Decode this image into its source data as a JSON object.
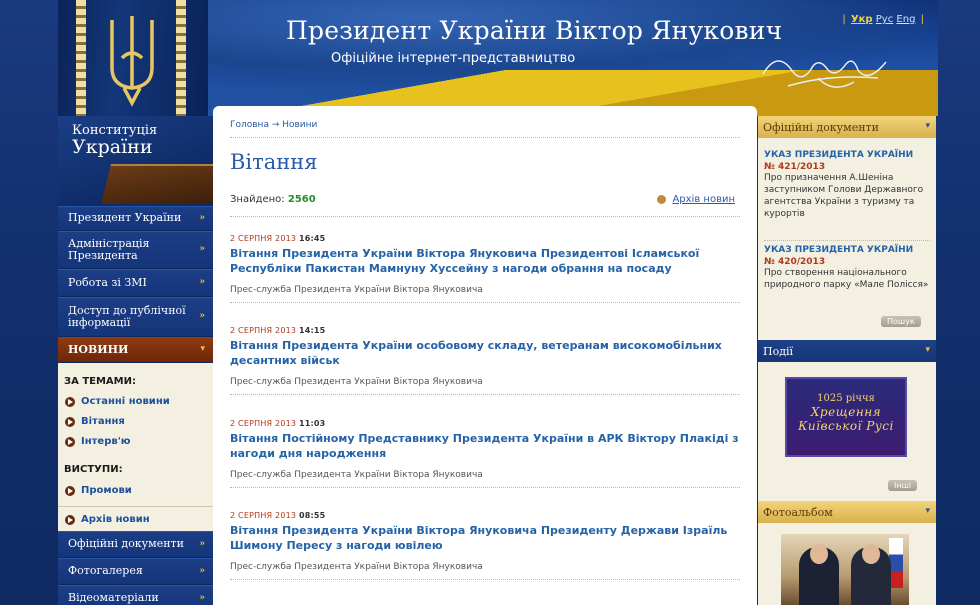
{
  "header": {
    "title": "Президент України Віктор Янукович",
    "subtitle": "Офіційне інтернет-представництво",
    "languages": [
      {
        "label": "Укр",
        "active": true
      },
      {
        "label": "Рус",
        "active": false
      },
      {
        "label": "Eng",
        "active": false
      }
    ]
  },
  "constitution": {
    "line1": "Конституція",
    "line2": "України"
  },
  "nav": [
    {
      "label": "Президент України"
    },
    {
      "label": "Адміністрація Президента"
    },
    {
      "label": "Робота зі ЗМІ"
    },
    {
      "label": "Доступ до публічної інформації"
    },
    {
      "label": "НОВИНИ"
    },
    {
      "label": "Офіційні документи"
    },
    {
      "label": "Фотогалерея"
    },
    {
      "label": "Відеоматеріали"
    }
  ],
  "topics": {
    "heading": "ЗА ТЕМАМИ:",
    "items": [
      "Останні новини",
      "Вітання",
      "Інтерв'ю"
    ],
    "speeches_heading": "ВИСТУПИ:",
    "speeches": [
      "Промови"
    ],
    "archive": "Архів новин"
  },
  "main": {
    "breadcrumb": "Головна → Новини",
    "title": "Вітання",
    "found_label": "Знайдено:",
    "found_count": "2560",
    "archive_link": "Архів новин",
    "news": [
      {
        "date": "2 СЕРПНЯ 2013",
        "time": "16:45",
        "title": "Вітання Президента України Віктора Януковича Президентові Ісламської Республіки Пакистан Мамнуну Хуссейну з нагоди обрання на посаду",
        "source": "Прес-служба Президента України Віктора Януковича"
      },
      {
        "date": "2 СЕРПНЯ 2013",
        "time": "14:15",
        "title": "Вітання Президента України особовому складу, ветеранам високомобільних десантних військ",
        "source": "Прес-служба Президента України Віктора Януковича"
      },
      {
        "date": "2 СЕРПНЯ 2013",
        "time": "11:03",
        "title": "Вітання Постійному Представнику Президента України в АРК Віктору Плакіді з нагоди дня народження",
        "source": "Прес-служба Президента України Віктора Януковича"
      },
      {
        "date": "2 СЕРПНЯ 2013",
        "time": "08:55",
        "title": "Вітання Президента України Віктора Януковича Президенту Держави Ізраїль Шимону Пересу з нагоди ювілею",
        "source": "Прес-служба Президента України Віктора Януковича"
      }
    ]
  },
  "right": {
    "docs_heading": "Офіційні документи",
    "docs": [
      {
        "type": "УКАЗ ПРЕЗИДЕНТА УКРАЇНИ",
        "number": "№ 421/2013",
        "desc": "Про призначення А.Шеніна заступником Голови Державного агентства України з туризму та курортів"
      },
      {
        "type": "УКАЗ ПРЕЗИДЕНТА УКРАЇНИ",
        "number": "№ 420/2013",
        "desc": "Про створення національного природного парку «Мале Полісся»"
      }
    ],
    "search_btn": "Пошук",
    "events_heading": "Події",
    "banner": {
      "line1": "1025 річчя",
      "line2": "Хрещення",
      "line3": "Київської Русі"
    },
    "other_btn": "Інші",
    "photo_heading": "Фотоальбом"
  },
  "colors": {
    "accent_blue": "#2563a8",
    "nav_blue": "#1c3e85",
    "news_red": "#8d3a12",
    "gold": "#f1c232"
  }
}
